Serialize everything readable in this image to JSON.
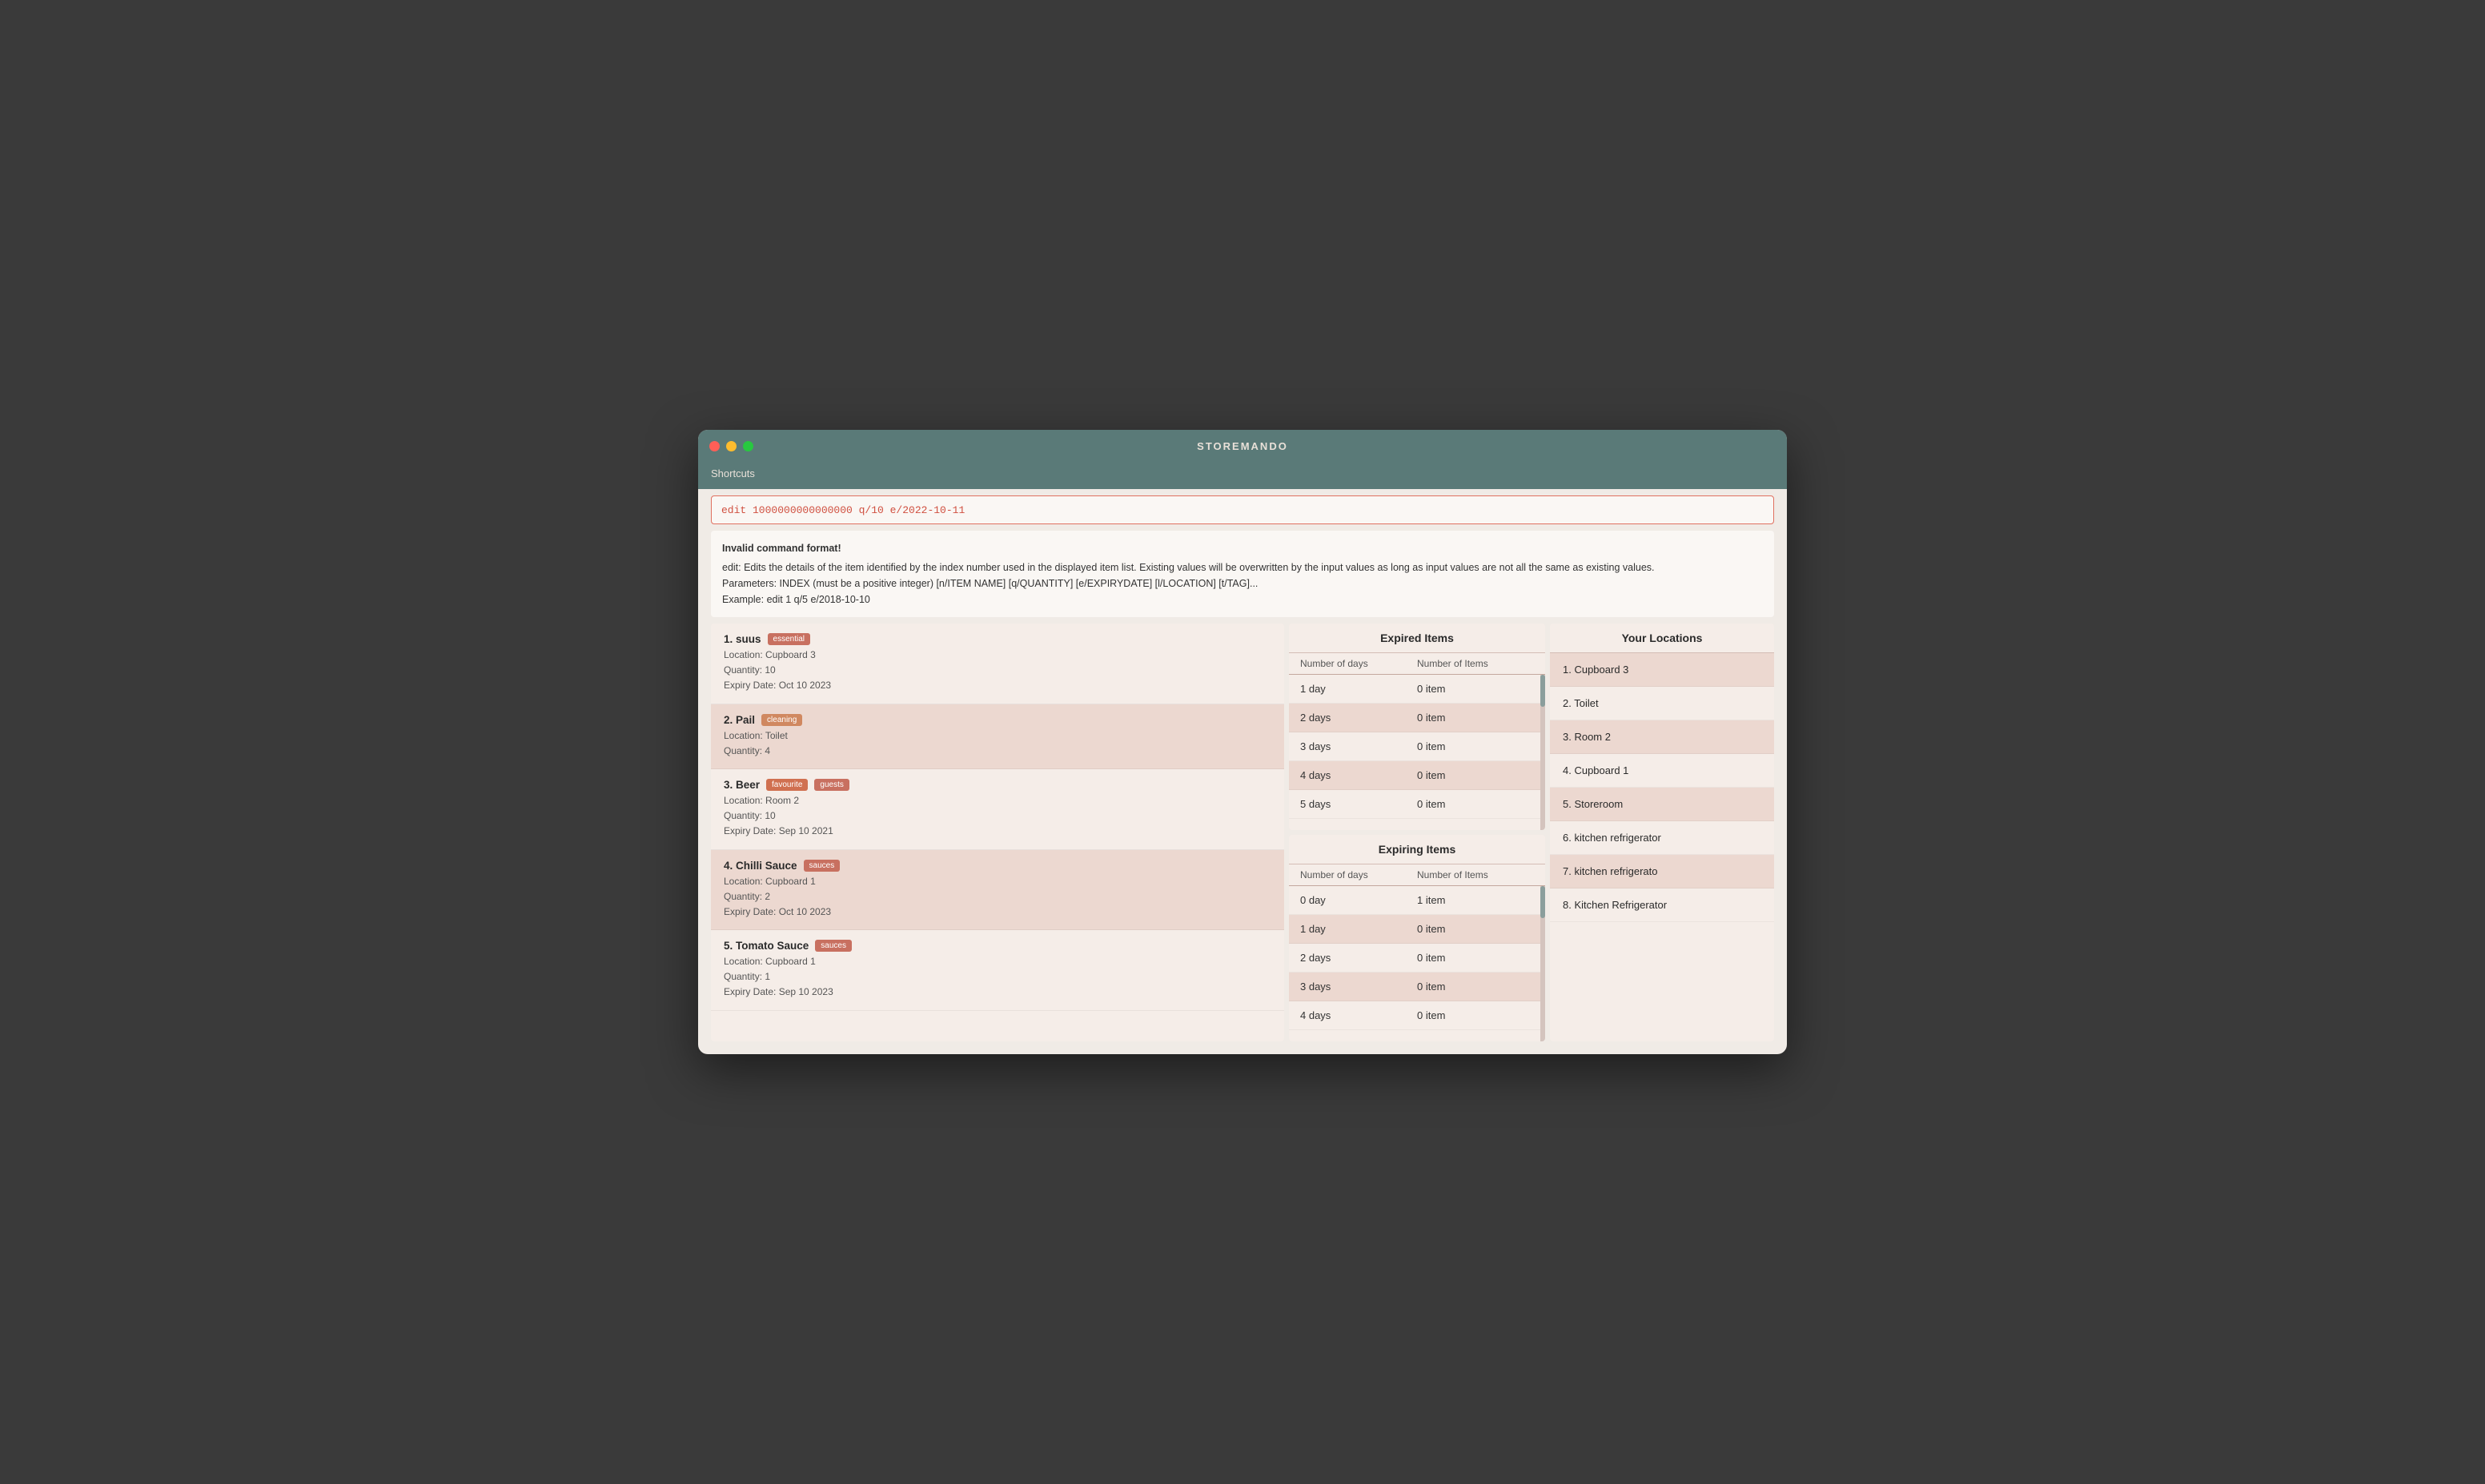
{
  "app": {
    "title": "STOREMANDO"
  },
  "shortcuts": {
    "label": "Shortcuts"
  },
  "command": {
    "text": "edit 1000000000000000 q/10 e/2022-10-11"
  },
  "error": {
    "line1": "Invalid command format!",
    "line2": "edit: Edits the details of the item identified by the index number used in the displayed item list. Existing values will be overwritten by the input values as long as input values are not all the same as existing values.",
    "line3": "Parameters: INDEX (must be a positive integer) [n/ITEM NAME] [q/QUANTITY] [e/EXPIRYDATE] [l/LOCATION] [t/TAG]...",
    "line4": "Example: edit 1 q/5 e/2018-10-10"
  },
  "items": [
    {
      "index": "1.",
      "name": "suus",
      "tags": [
        {
          "label": "essential",
          "class": "tag-essential"
        }
      ],
      "location": "Location: Cupboard 3",
      "quantity": "Quantity: 10",
      "expiry": "Expiry Date: Oct 10 2023"
    },
    {
      "index": "2.",
      "name": "Pail",
      "tags": [
        {
          "label": "cleaning",
          "class": "tag-cleaning"
        }
      ],
      "location": "Location: Toilet",
      "quantity": "Quantity: 4",
      "expiry": null
    },
    {
      "index": "3.",
      "name": "Beer",
      "tags": [
        {
          "label": "favourite",
          "class": "tag-favourite"
        },
        {
          "label": "guests",
          "class": "tag-guests"
        }
      ],
      "location": "Location: Room 2",
      "quantity": "Quantity: 10",
      "expiry": "Expiry Date: Sep 10 2021"
    },
    {
      "index": "4.",
      "name": "Chilli Sauce",
      "tags": [
        {
          "label": "sauces",
          "class": "tag-sauces"
        }
      ],
      "location": "Location: Cupboard 1",
      "quantity": "Quantity: 2",
      "expiry": "Expiry Date: Oct 10 2023"
    },
    {
      "index": "5.",
      "name": "Tomato Sauce",
      "tags": [
        {
          "label": "sauces",
          "class": "tag-sauces"
        }
      ],
      "location": "Location: Cupboard 1",
      "quantity": "Quantity: 1",
      "expiry": "Expiry Date: Sep 10 2023"
    }
  ],
  "expired_items": {
    "header": "Expired Items",
    "col_days": "Number of days",
    "col_items": "Number of Items",
    "rows": [
      {
        "days": "1 day",
        "items": "0 item"
      },
      {
        "days": "2 days",
        "items": "0 item"
      },
      {
        "days": "3 days",
        "items": "0 item"
      },
      {
        "days": "4 days",
        "items": "0 item"
      },
      {
        "days": "5 days",
        "items": "0 item"
      }
    ]
  },
  "expiring_items": {
    "header": "Expiring Items",
    "col_days": "Number of days",
    "col_items": "Number of Items",
    "rows": [
      {
        "days": "0 day",
        "items": "1 item"
      },
      {
        "days": "1 day",
        "items": "0 item"
      },
      {
        "days": "2 days",
        "items": "0 item"
      },
      {
        "days": "3 days",
        "items": "0 item"
      },
      {
        "days": "4 days",
        "items": "0 item"
      }
    ]
  },
  "locations": {
    "header": "Your Locations",
    "items": [
      {
        "index": "1.",
        "name": "Cupboard 3"
      },
      {
        "index": "2.",
        "name": "Toilet"
      },
      {
        "index": "3.",
        "name": "Room 2"
      },
      {
        "index": "4.",
        "name": "Cupboard 1"
      },
      {
        "index": "5.",
        "name": "Storeroom"
      },
      {
        "index": "6.",
        "name": "kitchen refrigerator"
      },
      {
        "index": "7.",
        "name": "kitchen refrigerato"
      },
      {
        "index": "8.",
        "name": "Kitchen Refrigerator"
      }
    ]
  }
}
